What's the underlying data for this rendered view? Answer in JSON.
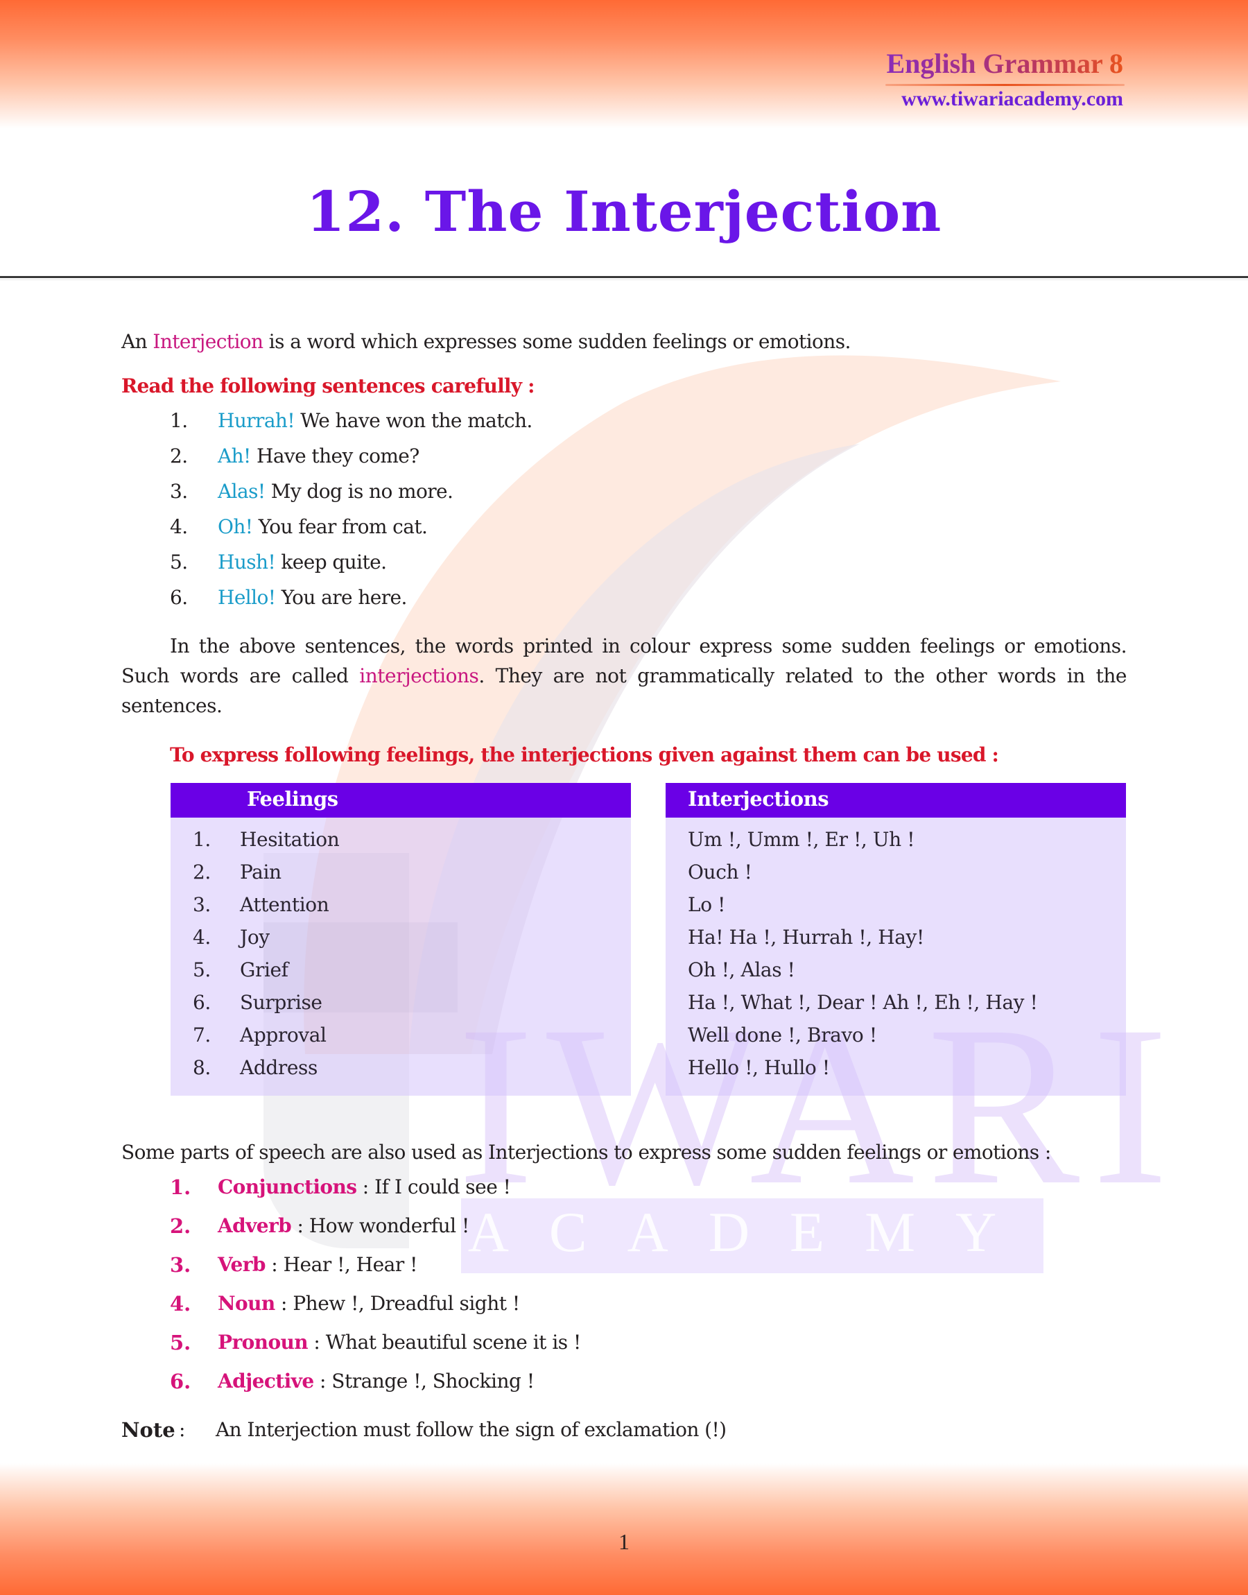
{
  "header": {
    "brand_title": "English Grammar 8",
    "brand_url": "www.tiwariacademy.com"
  },
  "page_title": "12. The Interjection",
  "intro": {
    "prefix": "An ",
    "term": "Interjection",
    "suffix": " is a word which expresses some sudden feelings or emotions."
  },
  "sentences_heading": "Read the following sentences carefully :",
  "sentences": [
    {
      "num": "1.",
      "interjection": "Hurrah!",
      "rest": " We have won the match."
    },
    {
      "num": "2.",
      "interjection": "Ah!",
      "rest": " Have they come?"
    },
    {
      "num": "3.",
      "interjection": "Alas!",
      "rest": " My dog is no more."
    },
    {
      "num": "4.",
      "interjection": "Oh!",
      "rest": " You fear from cat."
    },
    {
      "num": "5.",
      "interjection": "Hush!",
      "rest": " keep quite."
    },
    {
      "num": "6.",
      "interjection": "Hello!",
      "rest": " You are here."
    }
  ],
  "explanation": {
    "part1": "In the above sentences, the words printed in colour express some sudden feelings or emotions. Such words are called ",
    "term": "interjections",
    "part2": ". They are not grammatically related to the other words in the sentences."
  },
  "table_heading": "To express following feelings, the interjections given against them can be used :",
  "table": {
    "feelings_header": "Feelings",
    "interjections_header": "Interjections",
    "rows": [
      {
        "num": "1.",
        "feeling": "Hesitation",
        "interjections": "Um !, Umm !, Er !, Uh !"
      },
      {
        "num": "2.",
        "feeling": "Pain",
        "interjections": "Ouch !"
      },
      {
        "num": "3.",
        "feeling": "Attention",
        "interjections": "Lo !"
      },
      {
        "num": "4.",
        "feeling": "Joy",
        "interjections": "Ha! Ha !, Hurrah !, Hay!"
      },
      {
        "num": "5.",
        "feeling": "Grief",
        "interjections": "Oh !, Alas !"
      },
      {
        "num": "6.",
        "feeling": "Surprise",
        "interjections": "Ha !, What !, Dear ! Ah !, Eh !, Hay !"
      },
      {
        "num": "7.",
        "feeling": "Approval",
        "interjections": "Well done !, Bravo !"
      },
      {
        "num": "8.",
        "feeling": "Address",
        "interjections": "Hello !, Hullo !"
      }
    ]
  },
  "parts_intro": "Some parts of speech are also used as Interjections to express some sudden feelings or emotions :",
  "parts": [
    {
      "num": "1.",
      "label": "Conjunctions",
      "example": " : If I could see !"
    },
    {
      "num": "2.",
      "label": "Adverb",
      "example": " : How wonderful !"
    },
    {
      "num": "3.",
      "label": "Verb",
      "example": " : Hear !, Hear !"
    },
    {
      "num": "4.",
      "label": "Noun",
      "example": " : Phew !, Dreadful sight !"
    },
    {
      "num": "5.",
      "label": "Pronoun",
      "example": " : What beautiful scene it is !"
    },
    {
      "num": "6.",
      "label": "Adjective",
      "example": " : Strange !, Shocking !"
    }
  ],
  "note": {
    "label": "Note",
    "colon": ":",
    "text": "An Interjection must follow the sign of exclamation (!)"
  },
  "watermark": {
    "word1": "IWARI",
    "word2": "ACADEMY"
  },
  "page_number": "1",
  "colors": {
    "title": "#6a16e8",
    "heading_red": "#d9172a",
    "term_pink": "#c8177f",
    "interjection_cyan": "#1a9cc9",
    "table_header": "#6a00e6",
    "header_orange": "#ff6a35"
  }
}
